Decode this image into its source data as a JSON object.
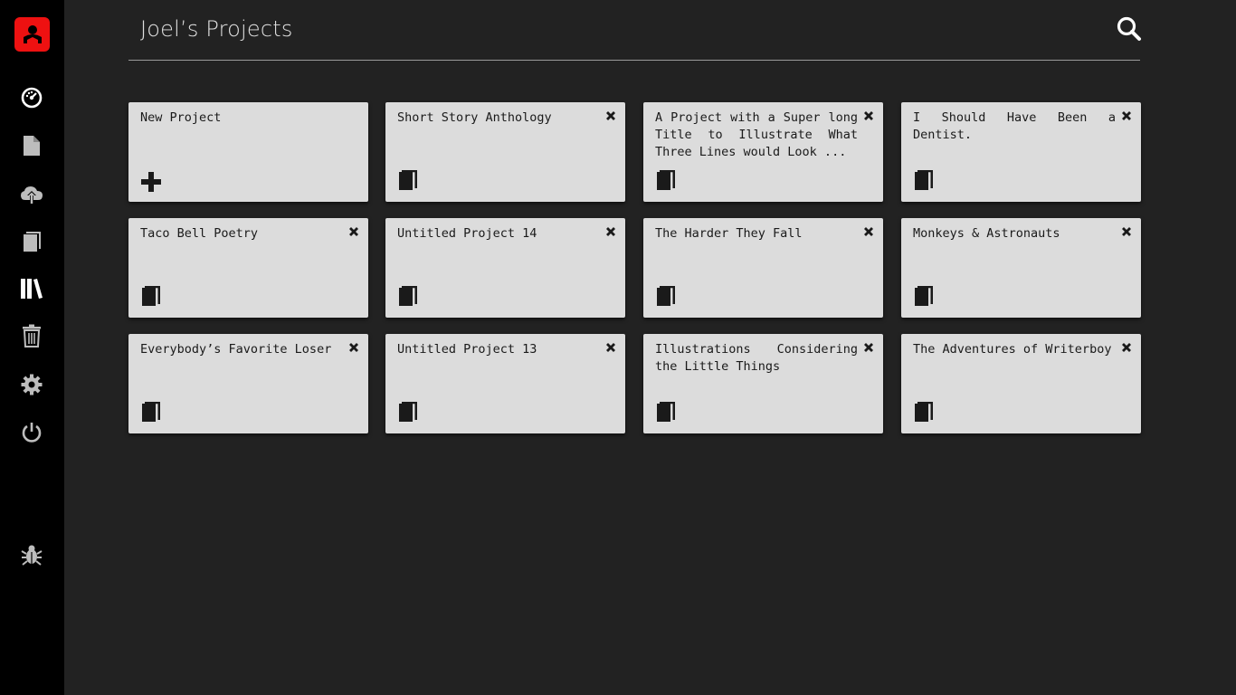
{
  "header": {
    "title": "Joel’s Projects"
  },
  "sidebar": {
    "items": [
      {
        "name": "dashboard-icon"
      },
      {
        "name": "file-icon"
      },
      {
        "name": "cloud-upload-icon"
      },
      {
        "name": "book-icon"
      },
      {
        "name": "library-icon"
      },
      {
        "name": "trash-icon"
      },
      {
        "name": "gear-icon"
      },
      {
        "name": "power-icon"
      },
      {
        "name": "bug-icon"
      }
    ]
  },
  "projects": {
    "new_label": "New Project",
    "items": [
      {
        "title": "Short Story Anthology"
      },
      {
        "title": "A Project with a Super long Title to Illustrate What Three Lines would Look ..."
      },
      {
        "title": "I Should Have Been a Dentist."
      },
      {
        "title": "Taco Bell Poetry"
      },
      {
        "title": "Untitled Project 14"
      },
      {
        "title": "The Harder They Fall"
      },
      {
        "title": "Monkeys & Astronauts"
      },
      {
        "title": "Everybody’s Favorite Loser"
      },
      {
        "title": "Untitled Project 13"
      },
      {
        "title": "Illustrations Considering the Little Things"
      },
      {
        "title": "The Adventures of Writerboy"
      }
    ]
  },
  "colors": {
    "accent": "#ee1111",
    "card": "#dcdcdc",
    "background": "#222222",
    "sidebar": "#000000"
  }
}
